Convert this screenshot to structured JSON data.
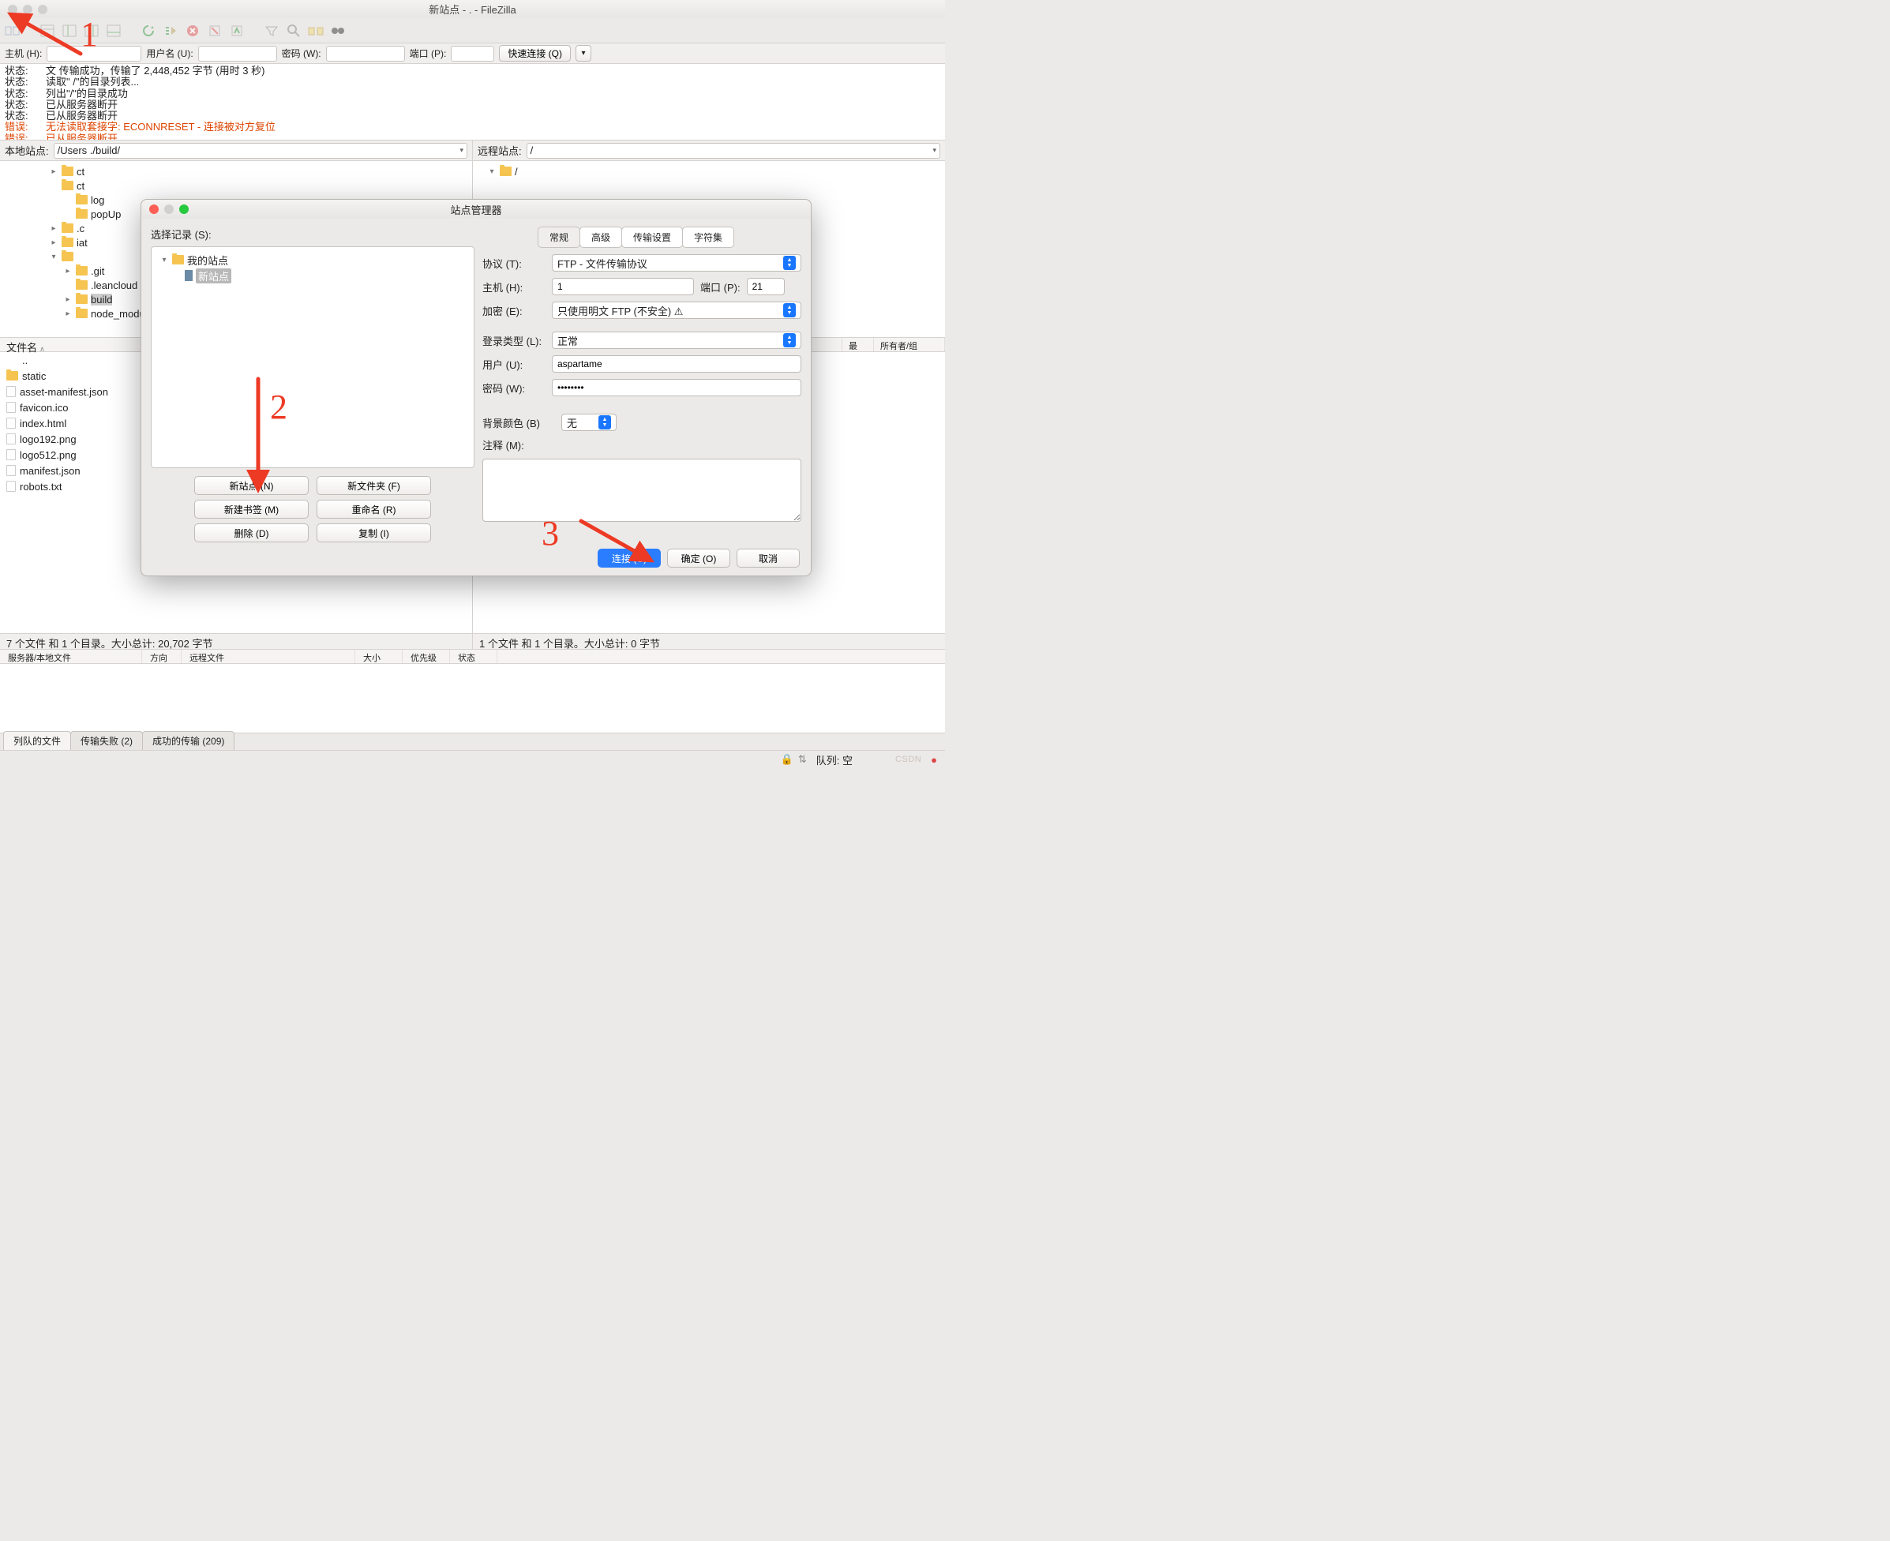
{
  "titlebar": {
    "title": "新站点 - .                               - FileZilla"
  },
  "quickbar": {
    "host_label": "主机 (H):",
    "user_label": "用户名 (U):",
    "pass_label": "密码 (W):",
    "port_label": "端口 (P):",
    "quick_connect": "快速连接 (Q)"
  },
  "log": [
    {
      "label": "状态:",
      "text": "文  传输成功，传输了 2,448,452 字节 (用时 3 秒)",
      "err": false
    },
    {
      "label": "状态:",
      "text": "读取\"  /\"的目录列表...",
      "err": false
    },
    {
      "label": "状态:",
      "text": "列出\"/\"的目录成功",
      "err": false
    },
    {
      "label": "状态:",
      "text": "已从服务器断开",
      "err": false
    },
    {
      "label": "状态:",
      "text": "已从服务器断开",
      "err": false
    },
    {
      "label": "错误:",
      "text": "无法读取套接字: ECONNRESET - 连接被对方复位",
      "err": true
    },
    {
      "label": "错误:",
      "text": "已从服务器断开",
      "err": true
    }
  ],
  "sites": {
    "local_label": "本地站点:",
    "local_path": "/Users                        ./build/",
    "remote_label": "远程站点:",
    "remote_path": "/"
  },
  "local_tree": [
    {
      "indent": 62,
      "name": "    ct",
      "exp": "▸"
    },
    {
      "indent": 62,
      "name": "       ct",
      "exp": ""
    },
    {
      "indent": 80,
      "name": "log",
      "exp": ""
    },
    {
      "indent": 80,
      "name": "popUp",
      "exp": ""
    },
    {
      "indent": 62,
      "name": "     .c",
      "exp": "▸"
    },
    {
      "indent": 62,
      "name": "      iat",
      "exp": "▸"
    },
    {
      "indent": 62,
      "name": "",
      "exp": "▾"
    },
    {
      "indent": 80,
      "name": ".git",
      "exp": "▸"
    },
    {
      "indent": 80,
      "name": ".leancloud",
      "exp": ""
    },
    {
      "indent": 80,
      "name": "build",
      "exp": "▸",
      "sel": true
    },
    {
      "indent": 80,
      "name": "node_modu",
      "exp": "▸"
    }
  ],
  "remote_tree": [
    {
      "indent": 18,
      "name": "/",
      "exp": "▾"
    }
  ],
  "file_header": {
    "name": "文件名",
    "sort": "∧",
    "remote_cols": [
      "最",
      "所有者/组"
    ]
  },
  "local_files": [
    {
      "name": "..",
      "icon": "none"
    },
    {
      "name": "static",
      "icon": "folder"
    },
    {
      "name": "asset-manifest.json",
      "icon": "file"
    },
    {
      "name": "favicon.ico",
      "icon": "file"
    },
    {
      "name": "index.html",
      "icon": "file"
    },
    {
      "name": "logo192.png",
      "icon": "file"
    },
    {
      "name": "logo512.png",
      "icon": "file"
    },
    {
      "name": "manifest.json",
      "icon": "file"
    },
    {
      "name": "robots.txt",
      "icon": "file"
    }
  ],
  "summary": {
    "local": "7 个文件 和 1 个目录。大小总计: 20,702 字节",
    "remote": "1 个文件 和 1 个目录。大小总计: 0 字节"
  },
  "queue_header": [
    "服务器/本地文件",
    "方向",
    "远程文件",
    "大小",
    "优先级",
    "状态"
  ],
  "bottom_tabs": [
    "列队的文件",
    "传输失败 (2)",
    "成功的传输 (209)"
  ],
  "statusbar": {
    "queue": "队列: 空",
    "watermark": "CSDN"
  },
  "dialog": {
    "title": "站点管理器",
    "select_label": "选择记录 (S):",
    "tree": {
      "root": "我的站点",
      "item": "新站点"
    },
    "left_buttons": [
      "新站点 (N)",
      "新文件夹 (F)",
      "新建书签 (M)",
      "重命名 (R)",
      "删除 (D)",
      "复制 (I)"
    ],
    "tabs": [
      "常规",
      "高级",
      "传输设置",
      "字符集"
    ],
    "form": {
      "protocol_label": "协议 (T):",
      "protocol_value": "FTP - 文件传输协议",
      "host_label": "主机 (H):",
      "host_value": "1",
      "port_label": "端口 (P):",
      "port_value": "21",
      "encryption_label": "加密 (E):",
      "encryption_value": "只使用明文 FTP (不安全) ⚠",
      "logon_label": "登录类型 (L):",
      "logon_value": "正常",
      "user_label": "用户 (U):",
      "user_value": "aspartame",
      "pass_label": "密码 (W):",
      "pass_value": "••••••••",
      "bgcolor_label": "背景颜色 (B)",
      "bgcolor_value": "无",
      "comment_label": "注释 (M):"
    },
    "footer": [
      "连接 (C)",
      "确定 (O)",
      "取消"
    ]
  },
  "annotations": {
    "one": "1",
    "two": "2",
    "three": "3"
  }
}
